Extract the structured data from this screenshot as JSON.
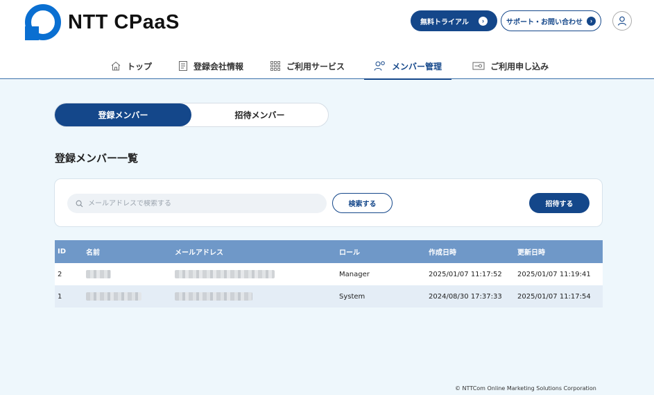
{
  "header": {
    "logo_text": "NTT CPaaS",
    "trial_label": "無料トライアル",
    "support_label": "サポート・お問い合わせ"
  },
  "nav": {
    "items": [
      {
        "label": "トップ",
        "icon": "home-icon",
        "active": false
      },
      {
        "label": "登録会社情報",
        "icon": "document-icon",
        "active": false
      },
      {
        "label": "ご利用サービス",
        "icon": "grid-icon",
        "active": false
      },
      {
        "label": "メンバー管理",
        "icon": "members-icon",
        "active": true
      },
      {
        "label": "ご利用申し込み",
        "icon": "key-card-icon",
        "active": false
      }
    ]
  },
  "tabs": {
    "registered": "登録メンバー",
    "invited": "招待メンバー",
    "active": "registered"
  },
  "section_title": "登録メンバー一覧",
  "search": {
    "placeholder": "メールアドレスで検索する",
    "value": "",
    "search_button": "検索する",
    "invite_button": "招待する"
  },
  "table": {
    "headers": {
      "id": "ID",
      "name": "名前",
      "email": "メールアドレス",
      "role": "ロール",
      "created": "作成日時",
      "updated": "更新日時"
    },
    "rows": [
      {
        "id": "2",
        "role": "Manager",
        "created": "2025/01/07 11:17:52",
        "updated": "2025/01/07 11:19:41"
      },
      {
        "id": "1",
        "role": "System",
        "created": "2024/08/30 17:37:33",
        "updated": "2025/01/07 11:17:54"
      }
    ]
  },
  "footer": "© NTTCom Online Marketing Solutions Corporation",
  "colors": {
    "brand": "#14478a",
    "logo_blue": "#0a6fd1",
    "table_header": "#6f98c8",
    "page_background": "#eef7fc"
  }
}
